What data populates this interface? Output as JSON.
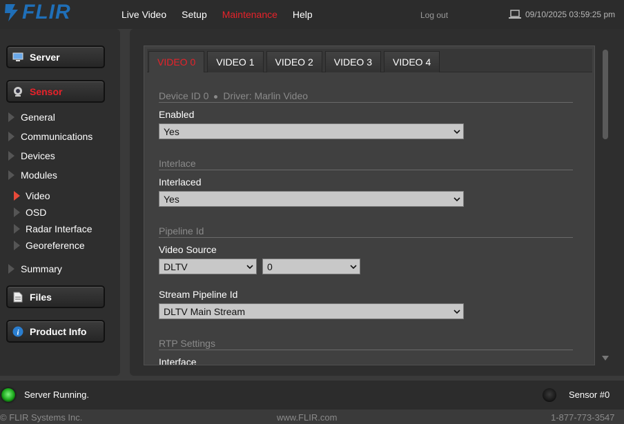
{
  "brand": {
    "logo_text": "FLIR",
    "logo_color": "#1f6fb8"
  },
  "nav": {
    "items": [
      {
        "label": "Live Video"
      },
      {
        "label": "Setup"
      },
      {
        "label": "Maintenance",
        "active": true
      },
      {
        "label": "Help"
      }
    ],
    "logout": "Log out",
    "datetime": "09/10/2025 03:59:25 pm"
  },
  "sidebar": {
    "server": "Server",
    "sensor": "Sensor",
    "items": [
      "General",
      "Communications",
      "Devices",
      "Modules"
    ],
    "subitems": [
      "Video",
      "OSD",
      "Radar Interface",
      "Georeference"
    ],
    "summary": "Summary",
    "files": "Files",
    "product_info": "Product Info"
  },
  "tabs": [
    "VIDEO 0",
    "VIDEO 1",
    "VIDEO 2",
    "VIDEO 3",
    "VIDEO 4"
  ],
  "form": {
    "device_header": {
      "id": "Device ID 0",
      "driver": "Driver: Marlin Video"
    },
    "enabled": {
      "label": "Enabled",
      "value": "Yes"
    },
    "interlace_section": "Interlace",
    "interlaced": {
      "label": "Interlaced",
      "value": "Yes"
    },
    "pipeline_section": "Pipeline Id",
    "video_source": {
      "label": "Video Source",
      "value": "DLTV",
      "index": "0"
    },
    "stream_pipeline": {
      "label": "Stream Pipeline Id",
      "value": "DLTV Main Stream"
    },
    "rtp_section": "RTP Settings",
    "interface": {
      "label": "Interface"
    }
  },
  "status": {
    "server": "Server Running.",
    "sensor": "Sensor #0"
  },
  "footer": {
    "company": "© FLIR Systems Inc.",
    "website": "www.FLIR.com",
    "phone": "1-877-773-3547"
  },
  "colors": {
    "accent_red": "#e8222a",
    "led_green": "#1aa61a"
  }
}
